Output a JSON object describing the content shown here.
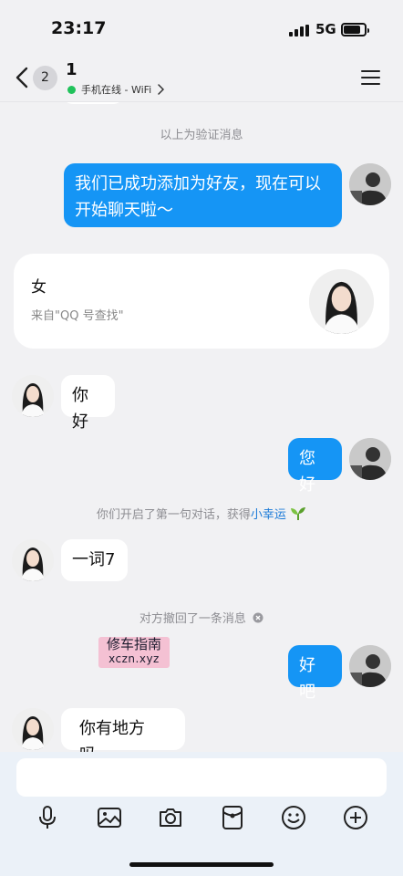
{
  "status_bar": {
    "time": "23:17",
    "network": "5G"
  },
  "header": {
    "back_badge": "2",
    "title": "1",
    "status_text": "手机在线 - WiFi"
  },
  "messages": {
    "system_verify": "以上为验证消息",
    "out_1": "我们已成功添加为好友，现在可以开始聊天啦～",
    "profile_gender": "女",
    "profile_source": "来自\"QQ 号查找\"",
    "in_1": "你好",
    "out_2": "您好",
    "system_first_prefix": "你们开启了第一句对话，获得",
    "system_first_link": "小幸运",
    "in_2": "一词7",
    "system_recall": "对方撤回了一条消息",
    "out_3": "好吧",
    "in_3": "你有地方吗、"
  },
  "watermark": {
    "line1": "修车指南",
    "line2": "xczn.xyz"
  },
  "toolbar": {
    "icons": [
      "microphone-icon",
      "image-icon",
      "camera-icon",
      "red-packet-icon",
      "emoji-icon",
      "plus-icon"
    ]
  },
  "colors": {
    "accent": "#1595f5",
    "online": "#20c25b",
    "link": "#1a7ad8"
  }
}
